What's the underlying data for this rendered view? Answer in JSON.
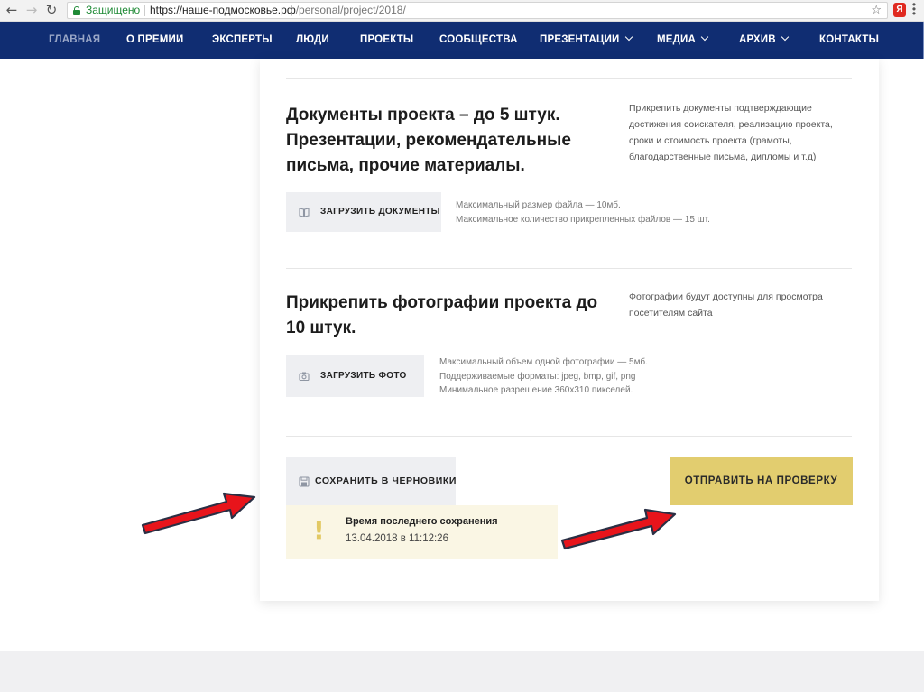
{
  "browser": {
    "back": "←",
    "forward": "→",
    "reload": "↻",
    "secure_label": "Защищено",
    "url_host": "https://наше-подмосковье.рф",
    "url_path": "/personal/project/2018/",
    "bookmark_star": "☆",
    "ext_badge": "Я",
    "menu_dots": "⋮"
  },
  "nav": {
    "items": [
      {
        "label": "ГЛАВНАЯ"
      },
      {
        "label": "О ПРЕМИИ"
      },
      {
        "label": "ЭКСПЕРТЫ"
      },
      {
        "label": "ЛЮДИ"
      },
      {
        "label": "ПРОЕКТЫ"
      },
      {
        "label": "СООБЩЕСТВА"
      },
      {
        "label": "ПРЕЗЕНТАЦИИ"
      },
      {
        "label": "МЕДИА"
      },
      {
        "label": "АРХИВ"
      },
      {
        "label": "КОНТАКТЫ"
      }
    ]
  },
  "documents": {
    "title_line1": "Документы проекта – до 5 штук.",
    "title_line2": "Презентации, рекомендательные",
    "title_line3": "письма, прочие материалы.",
    "hint_lines": [
      "Прикрепить документы подтверждающие",
      "достижения соискателя, реализацию проекта,",
      "сроки и стоимость проекта (грамоты,",
      "благодарственные письма, дипломы и т.д)"
    ],
    "button": "ЗАГРУЗИТЬ ДОКУМЕНТЫ",
    "notes": [
      "Максимальный размер файла — 10мб.",
      "Максимальное количество прикрепленных файлов — 15 шт."
    ]
  },
  "photos": {
    "title_line1": "Прикрепить фотографии проекта до",
    "title_line2": "10 штук.",
    "hint_lines": [
      "Фотографии будут доступны для просмотра",
      "посетителям сайта"
    ],
    "button": "ЗАГРУЗИТЬ ФОТО",
    "notes": [
      "Максимальный объем одной фотографии — 5мб.",
      "Поддерживаемые форматы: jpeg, bmp, gif, png",
      "Минимальное разрешение 360х310 пикселей."
    ]
  },
  "actions": {
    "save_draft": "СОХРАНИТЬ В ЧЕРНОВИКИ",
    "last_save_label": "Время последнего сохранения",
    "last_save_time": "13.04.2018 в 11:12:26",
    "submit": "ОТПРАВИТЬ НА ПРОВЕРКУ",
    "warning_mark": "!"
  },
  "colors": {
    "nav_bg": "#102d72",
    "submit_bg": "#e2cd6f",
    "arrow_red": "#e8141b"
  }
}
